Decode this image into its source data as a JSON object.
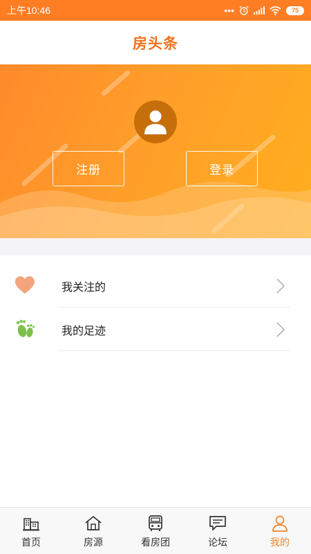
{
  "status_bar": {
    "time": "上午10:46",
    "battery": "75"
  },
  "header": {
    "title": "房头条"
  },
  "hero": {
    "register_label": "注册",
    "login_label": "登录"
  },
  "menu": {
    "items": [
      {
        "label": "我关注的",
        "icon": "heart-icon"
      },
      {
        "label": "我的足迹",
        "icon": "footprint-icon"
      }
    ]
  },
  "tabs": [
    {
      "label": "首页",
      "icon": "home-buildings-icon",
      "active": false
    },
    {
      "label": "房源",
      "icon": "house-icon",
      "active": false
    },
    {
      "label": "看房团",
      "icon": "bus-icon",
      "active": false
    },
    {
      "label": "论坛",
      "icon": "chat-icon",
      "active": false
    },
    {
      "label": "我的",
      "icon": "person-icon",
      "active": true
    }
  ],
  "colors": {
    "brand_orange": "#ff7e24",
    "title_orange": "#f2701b",
    "active_tab": "#f2842a",
    "heart": "#f4a47c",
    "footprint": "#7cc04a"
  }
}
